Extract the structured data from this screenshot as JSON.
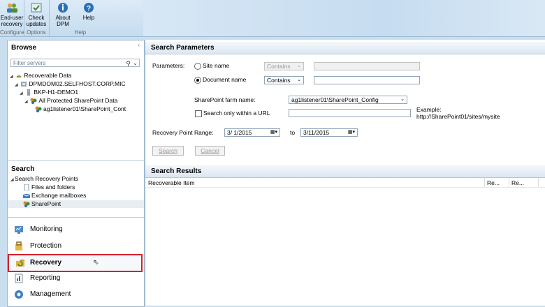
{
  "ribbon": {
    "buttons": [
      {
        "label1": "End-user",
        "label2": "recovery",
        "icon": "user-group-icon"
      },
      {
        "label1": "Check",
        "label2": "updates",
        "icon": "check-updates-icon"
      },
      {
        "label1": "About",
        "label2": "DPM",
        "icon": "info-icon"
      },
      {
        "label1": "Help",
        "label2": "",
        "icon": "help-icon"
      }
    ],
    "groups": [
      "Configure",
      "Options",
      "Help"
    ]
  },
  "browse": {
    "title": "Browse",
    "filter_placeholder": "Filter servers",
    "tree": [
      {
        "label": "Recoverable Data",
        "icon": "recoverable-data-icon"
      },
      {
        "label": "DPMDOM02.SELFHOST.CORP.MIC",
        "icon": "domain-icon"
      },
      {
        "label": "BKP-H1-DEMO1",
        "icon": "server-icon"
      },
      {
        "label": "All Protected SharePoint Data",
        "icon": "sharepoint-icon"
      },
      {
        "label": "ag1listener01\\SharePoint_Cont",
        "icon": "sharepoint-icon"
      }
    ]
  },
  "search": {
    "title": "Search",
    "root": "Search Recovery Points",
    "items": [
      "Files and folders",
      "Exchange mailboxes",
      "SharePoint"
    ]
  },
  "nav": [
    {
      "label": "Monitoring",
      "icon": "monitoring-icon"
    },
    {
      "label": "Protection",
      "icon": "protection-icon"
    },
    {
      "label": "Recovery",
      "icon": "recovery-icon"
    },
    {
      "label": "Reporting",
      "icon": "reporting-icon"
    },
    {
      "label": "Management",
      "icon": "management-icon"
    }
  ],
  "params": {
    "title": "Search Parameters",
    "parameters_label": "Parameters:",
    "site_name": "Site name",
    "document_name": "Document name",
    "contains1": "Contains",
    "contains2": "Contains",
    "farm_label": "SharePoint farm name:",
    "farm_value": "ag1listener01\\SharePoint_Config",
    "url_label": "Search only within a URL",
    "example_label": "Example:",
    "example_url": "http://SharePoint01/sites/mysite",
    "range_label": "Recovery Point Range:",
    "from_date": "3/ 1/2015",
    "to_label": "to",
    "to_date": "3/11/2015",
    "search_button": "Search",
    "cancel_button": "Cancel"
  },
  "results": {
    "title": "Search Results",
    "columns": [
      "Recoverable Item",
      "Re...",
      "Re..."
    ]
  },
  "colors": {
    "accent": "#d7202a",
    "panel_border": "#9db9d3"
  }
}
